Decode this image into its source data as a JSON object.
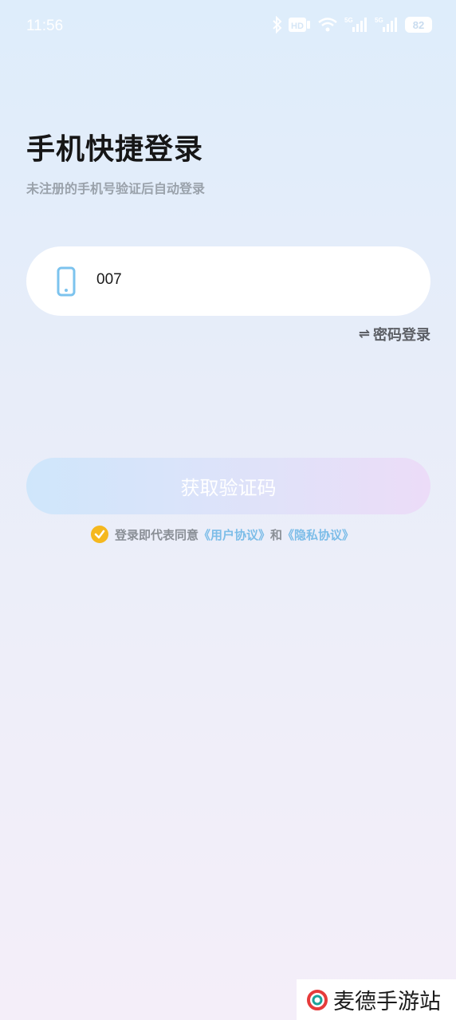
{
  "status_bar": {
    "time": "11:56",
    "battery": "82",
    "icons": [
      "bluetooth-icon",
      "hd-icon",
      "wifi-icon",
      "5g-signal-icon",
      "5g-signal-icon"
    ]
  },
  "page": {
    "title": "手机快捷登录",
    "subtitle": "未注册的手机号验证后自动登录"
  },
  "phone_field": {
    "icon": "phone-icon",
    "value": "007"
  },
  "switch_login": {
    "icon": "swap-icon",
    "label": "密码登录"
  },
  "get_code_button": {
    "label": "获取验证码"
  },
  "agreement": {
    "checked": true,
    "prefix": "登录即代表同意",
    "user_agreement": "《用户协议》",
    "and": "和",
    "privacy_policy": "《隐私协议》"
  },
  "watermark": {
    "text": "麦德手游站"
  },
  "colors": {
    "accent_link": "#7cbde8",
    "check": "#f5b81f",
    "phone_icon": "#7cc3ee"
  }
}
